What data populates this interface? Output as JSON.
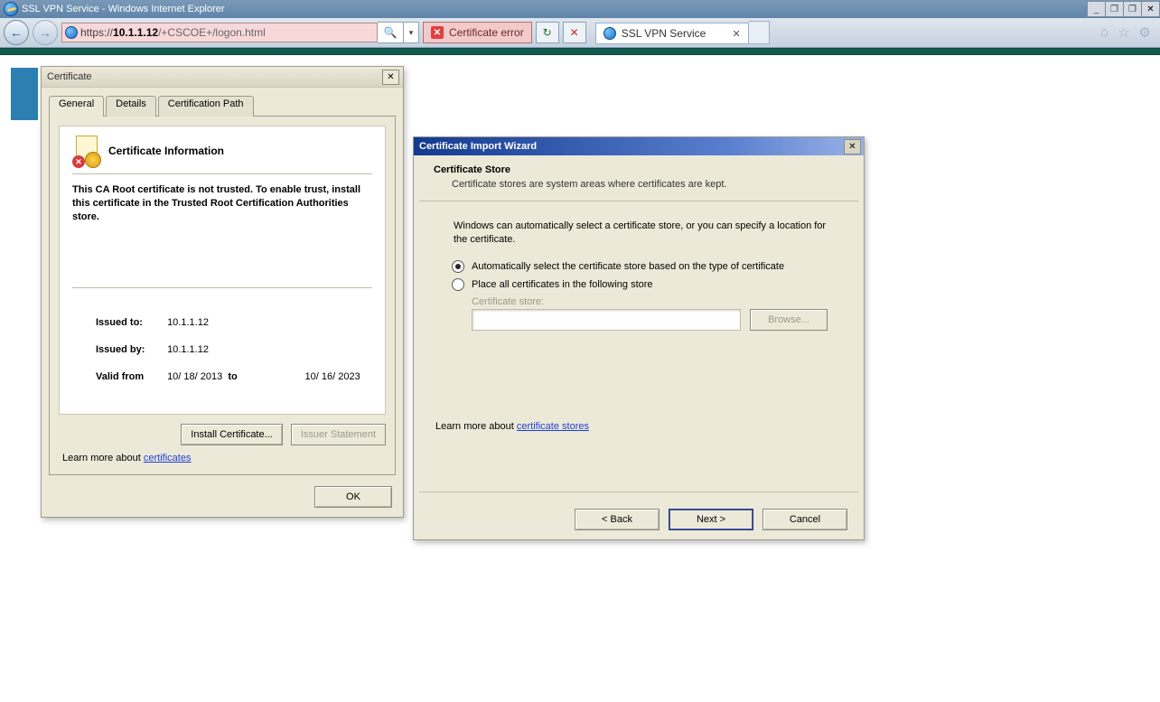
{
  "window": {
    "title": "SSL VPN Service - Windows Internet Explorer",
    "controls": {
      "min": "_",
      "max": "❐",
      "restore": "❐",
      "close": "✕"
    }
  },
  "nav": {
    "address_proto": "https://",
    "address_host": "10.1.1.12",
    "address_path": "/+CSCOE+/logon.html",
    "cert_error": "Certificate error",
    "tab_title": "SSL VPN Service"
  },
  "certDialog": {
    "title": "Certificate",
    "tabs": {
      "general": "General",
      "details": "Details",
      "path": "Certification Path"
    },
    "heading": "Certificate Information",
    "warning": "This CA Root certificate is not trusted. To enable trust, install this certificate in the Trusted Root Certification Authorities store.",
    "issued_to_label": "Issued to:",
    "issued_to": "10.1.1.12",
    "issued_by_label": "Issued by:",
    "issued_by": "10.1.1.12",
    "valid_from_label": "Valid from",
    "valid_from": "10/ 18/ 2013",
    "valid_to_label": "to",
    "valid_to": "10/ 16/ 2023",
    "install_btn": "Install Certificate...",
    "issuer_btn": "Issuer Statement",
    "learn_prefix": "Learn more about ",
    "learn_link": "certificates",
    "ok": "OK"
  },
  "wizard": {
    "title": "Certificate Import Wizard",
    "section": "Certificate Store",
    "section_sub": "Certificate stores are system areas where certificates are kept.",
    "instruction": "Windows can automatically select a certificate store, or you can specify a location for the certificate.",
    "opt_auto": "Automatically select the certificate store based on the type of certificate",
    "opt_place": "Place all certificates in the following store",
    "store_label": "Certificate store:",
    "browse": "Browse...",
    "learn_prefix": "Learn more about ",
    "learn_link": "certificate stores",
    "back": "< Back",
    "next": "Next >",
    "cancel": "Cancel"
  }
}
